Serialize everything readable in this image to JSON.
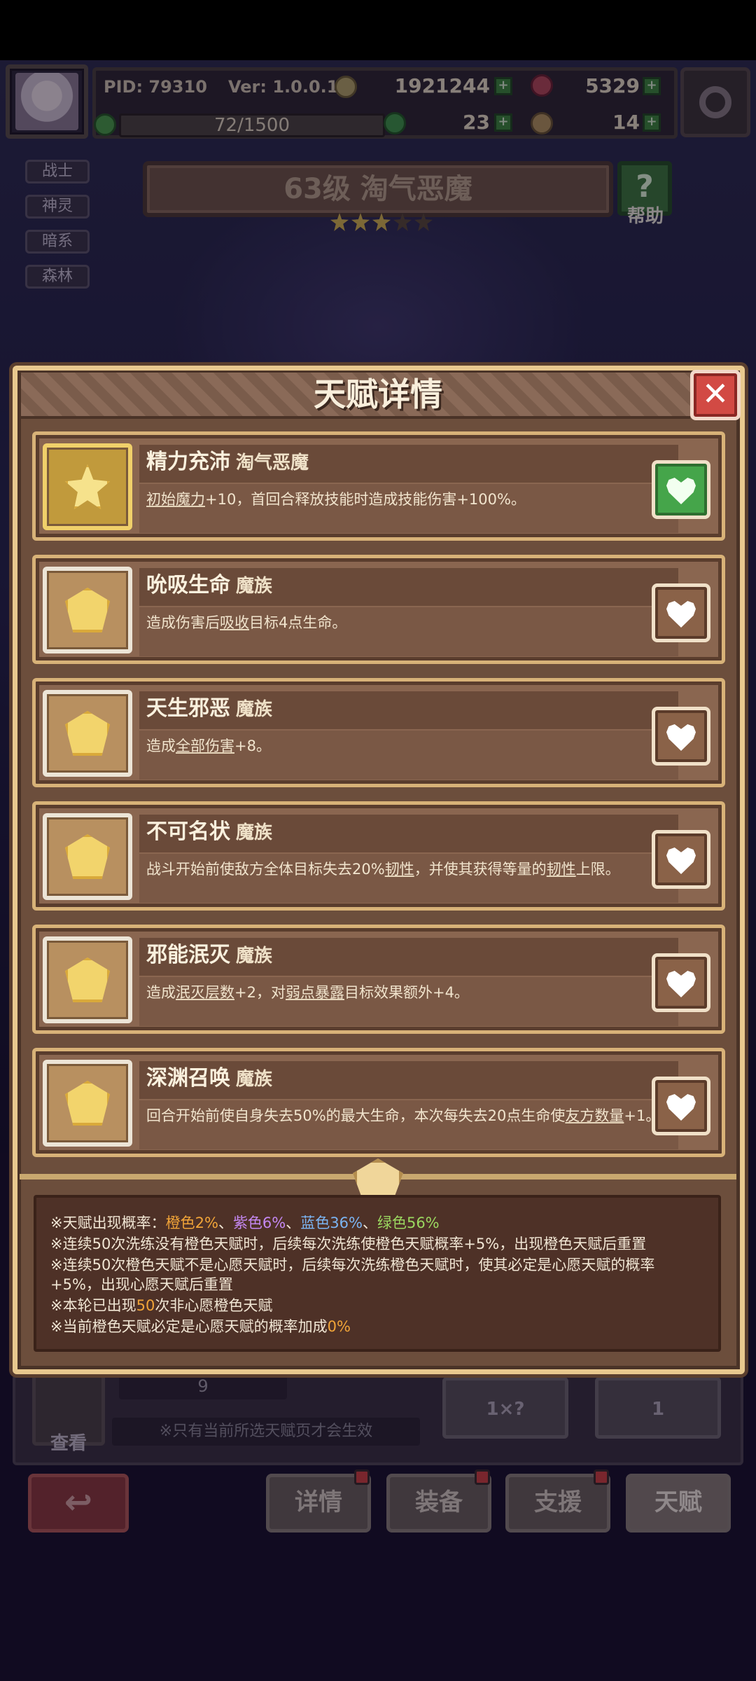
{
  "hud": {
    "pid": "PID: 79310",
    "version": "Ver: 1.0.0.10",
    "gold": "1921244",
    "gems": "5329",
    "exp": "72/1500",
    "clover": "23",
    "boots": "14"
  },
  "side_tags": [
    "战士",
    "神灵",
    "暗系",
    "森林"
  ],
  "hero_title": "63级  淘气恶魔",
  "help_label": "帮助",
  "stars": {
    "filled": 3,
    "total": 5
  },
  "modal": {
    "title": "天赋详情",
    "close": "✕"
  },
  "talents": [
    {
      "name": "精力充沛",
      "race": "淘气恶魔",
      "desc_html": "<u>初始魔力</u>+10，首回合释放技能时造成技能伤害+100%。",
      "wished": true,
      "gold": true
    },
    {
      "name": "吮吸生命",
      "race": "魔族",
      "desc_html": "造成伤害后<u>吸收</u>目标4点生命。",
      "wished": false,
      "gold": false
    },
    {
      "name": "天生邪恶",
      "race": "魔族",
      "desc_html": "造成<u>全部伤害</u>+8。",
      "wished": false,
      "gold": false
    },
    {
      "name": "不可名状",
      "race": "魔族",
      "desc_html": "战斗开始前使敌方全体目标失去20%<u>韧性</u>，并使其获得等量的<u>韧性</u>上限。",
      "wished": false,
      "gold": false
    },
    {
      "name": "邪能泯灭",
      "race": "魔族",
      "desc_html": "造成<u>泯灭层数</u>+2，对<u>弱点暴露</u>目标效果额外+4。",
      "wished": false,
      "gold": false
    },
    {
      "name": "深渊召唤",
      "race": "魔族",
      "desc_html": "回合开始前使自身失去50%的最大生命，本次每失去20点生命使<u>友方数量</u>+1。",
      "wished": false,
      "gold": false
    }
  ],
  "info": {
    "line1_prefix": "※天赋出现概率：",
    "orange": "橙色2%",
    "purple": "紫色6%",
    "blue": "蓝色36%",
    "green": "绿色56%",
    "sep": "、",
    "line2": "※连续50次洗练没有橙色天赋时，后续每次洗练使橙色天赋概率+5%，出现橙色天赋后重置",
    "line3a": "※连续50次橙色天赋不是心愿天赋时，后续每次洗练橙色天赋时，使其必定是心愿天赋的概率",
    "line3b": "+5%，出现心愿天赋后重置",
    "line4_pre": "※本轮已出现",
    "line4_num": "50",
    "line4_post": "次非心愿橙色天赋",
    "line5_pre": "※当前橙色天赋必定是心愿天赋的概率加成",
    "line5_num": "0%"
  },
  "lower": {
    "count": "9",
    "view_label": "查看",
    "note": "※只有当前所选天赋页才会生效",
    "reroll_left": "1×?",
    "reroll_right": "1"
  },
  "tabs": [
    "详情",
    "装备",
    "支援",
    "天赋"
  ],
  "colors": {
    "orange": "#f1a438",
    "purple": "#c488f2",
    "blue": "#7bb4f2",
    "green": "#9bd860"
  }
}
